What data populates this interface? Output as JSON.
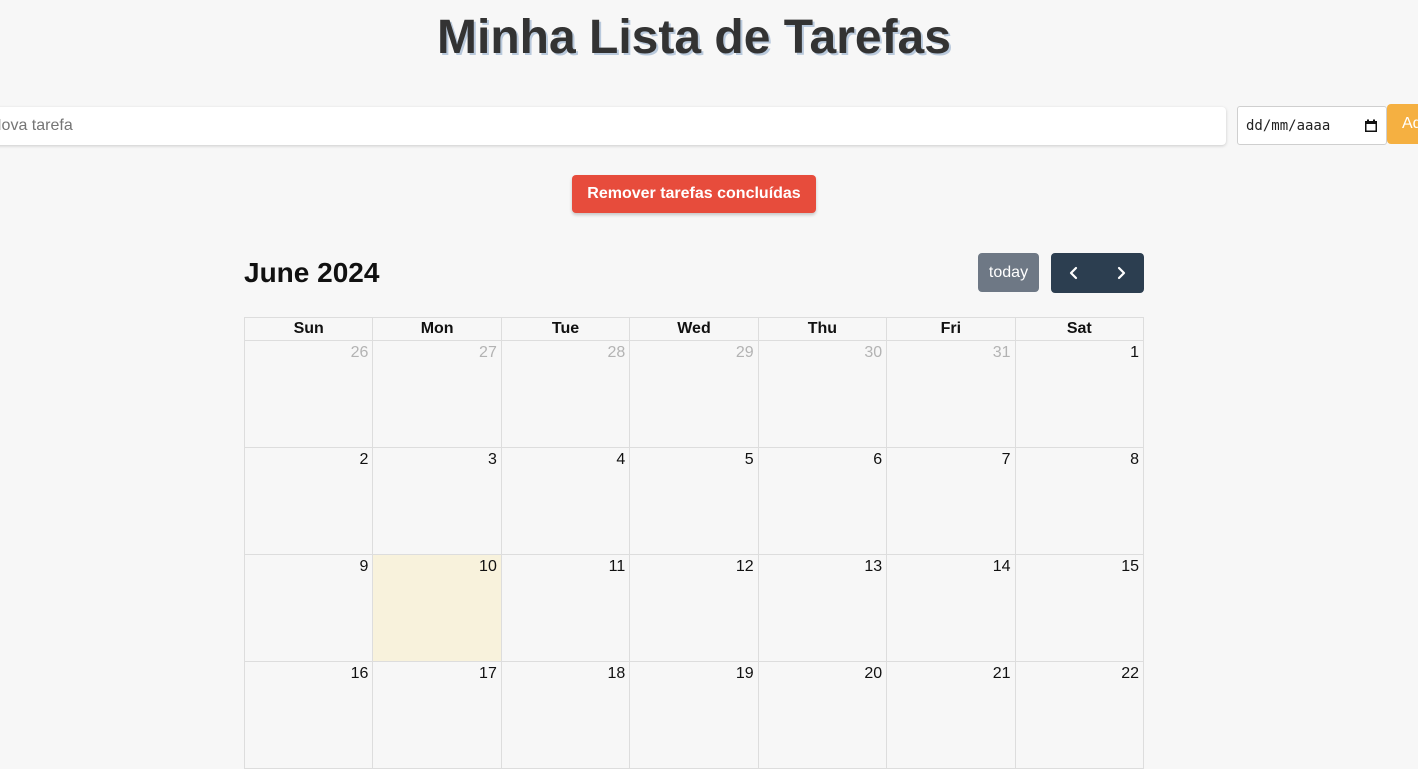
{
  "header": {
    "title": "Minha Lista de Tarefas"
  },
  "form": {
    "task_placeholder": "Nova tarefa",
    "date_placeholder": "dd/mm/aaaa",
    "add_label": "Adicionar"
  },
  "actions": {
    "remove_completed_label": "Remover tarefas concluídas"
  },
  "calendar": {
    "title": "June 2024",
    "today_label": "today",
    "prev_icon": "chevron-left-icon",
    "next_icon": "chevron-right-icon",
    "weekdays": [
      "Sun",
      "Mon",
      "Tue",
      "Wed",
      "Thu",
      "Fri",
      "Sat"
    ],
    "weeks": [
      [
        {
          "day": "26",
          "other": true
        },
        {
          "day": "27",
          "other": true
        },
        {
          "day": "28",
          "other": true
        },
        {
          "day": "29",
          "other": true
        },
        {
          "day": "30",
          "other": true
        },
        {
          "day": "31",
          "other": true
        },
        {
          "day": "1"
        }
      ],
      [
        {
          "day": "2"
        },
        {
          "day": "3"
        },
        {
          "day": "4"
        },
        {
          "day": "5"
        },
        {
          "day": "6"
        },
        {
          "day": "7"
        },
        {
          "day": "8"
        }
      ],
      [
        {
          "day": "9"
        },
        {
          "day": "10",
          "today": true
        },
        {
          "day": "11"
        },
        {
          "day": "12"
        },
        {
          "day": "13"
        },
        {
          "day": "14"
        },
        {
          "day": "15"
        }
      ],
      [
        {
          "day": "16"
        },
        {
          "day": "17"
        },
        {
          "day": "18"
        },
        {
          "day": "19"
        },
        {
          "day": "20"
        },
        {
          "day": "21"
        },
        {
          "day": "22"
        }
      ]
    ]
  },
  "colors": {
    "title_text": "#333333",
    "add_button": "#f5b041",
    "remove_button": "#e74c3c",
    "today_button": "#6e7885",
    "nav_buttons": "#2c3e50",
    "today_highlight": "#f8f2dc"
  }
}
